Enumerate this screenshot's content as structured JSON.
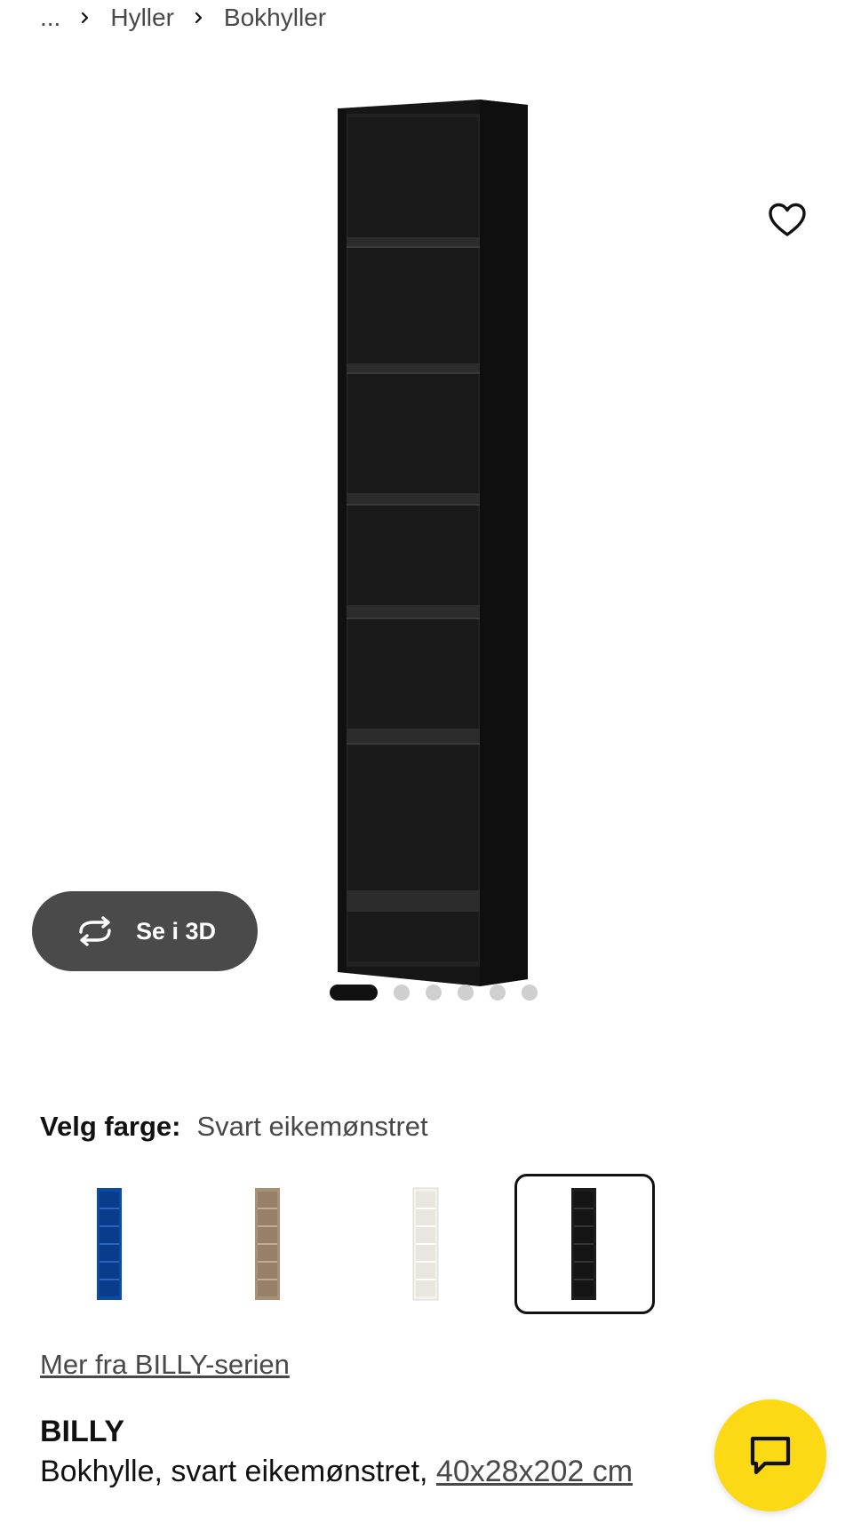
{
  "breadcrumb": {
    "items": [
      "...",
      "Hyller",
      "Bokhyller"
    ]
  },
  "gallery": {
    "see_3d_label": "Se i 3D",
    "slide_count": 6,
    "active_slide": 1,
    "product_color": "#1b1b1b"
  },
  "color_picker": {
    "label": "Velg farge:",
    "selected_value": "Svart eikemønstret",
    "options": [
      {
        "name": "blue",
        "color": "#0b4aa8"
      },
      {
        "name": "oak",
        "color": "#a89077"
      },
      {
        "name": "white",
        "color": "#f3f1ec"
      },
      {
        "name": "black",
        "color": "#1c1c1c"
      }
    ],
    "selected_index": 3
  },
  "series_link": "Mer fra BILLY-serien",
  "product": {
    "name": "BILLY",
    "description": "Bokhylle, svart eikemønstret, ",
    "dimensions": "40x28x202 cm"
  },
  "colors": {
    "accent": "#fbd914",
    "button_dark": "#4a4a4a",
    "text_muted": "#484848"
  }
}
